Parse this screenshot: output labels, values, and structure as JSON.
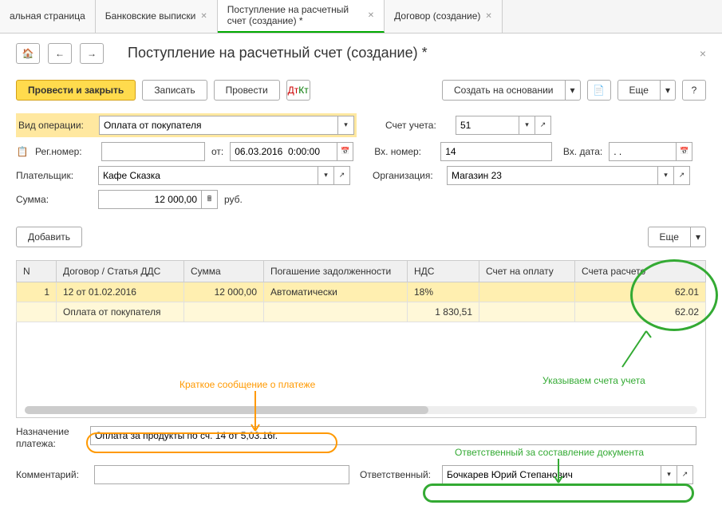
{
  "tabs": [
    {
      "label": "альная страница"
    },
    {
      "label": "Банковские выписки"
    },
    {
      "label": "Поступление на расчетный счет (создание) *",
      "active": true
    },
    {
      "label": "Договор (создание)"
    }
  ],
  "title": "Поступление на расчетный счет (создание) *",
  "toolbar": {
    "post_close": "Провести и закрыть",
    "save": "Записать",
    "post": "Провести",
    "create_based": "Создать на основании",
    "more": "Еще",
    "help": "?"
  },
  "form": {
    "op_label": "Вид операции:",
    "op_value": "Оплата от покупателя",
    "account_label": "Счет учета:",
    "account_value": "51",
    "reg_label": "Рег.номер:",
    "ot": "от:",
    "date": "06.03.2016  0:00:00",
    "vh_label": "Вх. номер:",
    "vh_value": "14",
    "vh_date_label": "Вх. дата:",
    "vh_date": ". .",
    "payer_label": "Плательщик:",
    "payer": "Кафе Сказка",
    "org_label": "Организация:",
    "org": "Магазин 23",
    "sum_label": "Сумма:",
    "sum": "12 000,00",
    "currency": "руб."
  },
  "table": {
    "add": "Добавить",
    "more": "Еще",
    "cols": {
      "n": "N",
      "contract": "Договор / Статья ДДС",
      "sum": "Сумма",
      "repay": "Погашение задолженности",
      "vat": "НДС",
      "invoice": "Счет на оплату",
      "acc": "Счета расчето"
    },
    "rows": [
      {
        "n": "1",
        "contract": "12 от 01.02.2016",
        "sum": "12 000,00",
        "repay": "Автоматически",
        "vat": "18%",
        "invoice": "",
        "acc": "62.01"
      },
      {
        "n": "",
        "contract": "Оплата от покупателя",
        "sum": "",
        "repay": "",
        "vat": "1 830,51",
        "invoice": "",
        "acc": "62.02"
      }
    ]
  },
  "bottom": {
    "purpose_label": "Назначение платежа:",
    "purpose": "Оплата за продукты по сч. 14 от 5,03.16г.",
    "comment_label": "Комментарий:",
    "resp_label": "Ответственный:",
    "resp": "Бочкарев Юрий Степанович"
  },
  "annotations": {
    "a1": "Указываем счета учета",
    "a2": "Краткое сообщение о платеже",
    "a3": "Ответственный за составление документа"
  }
}
